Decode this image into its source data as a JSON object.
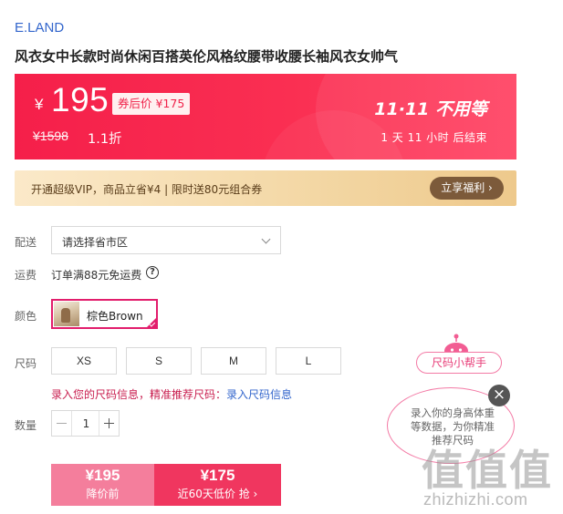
{
  "brand": "E.LAND",
  "product_title": "风衣女中长款时尚休闲百搭英伦风格纹腰带收腰长袖风衣女帅气",
  "price_banner": {
    "currency": "¥",
    "price": "195",
    "coupon_tag": "券后价 ¥175",
    "original_price": "¥1598",
    "discount": "1.1折",
    "promo_title": "11·11 不用等",
    "countdown": "1 天 11 小时 后结束"
  },
  "vip": {
    "text": "开通超级VIP，商品立省¥4 | 限时送80元组合券",
    "button": "立享福利 ›"
  },
  "delivery": {
    "label": "配送",
    "placeholder": "请选择省市区"
  },
  "freight": {
    "label": "运费",
    "text": "订单满88元免运费",
    "help_icon": "?"
  },
  "color": {
    "label": "颜色",
    "selected": "棕色Brown"
  },
  "size": {
    "label": "尺码",
    "options": [
      "XS",
      "S",
      "M",
      "L"
    ],
    "hint": "录入您的尺码信息，精准推荐尺码：",
    "hint_link": "录入尺码信息"
  },
  "quantity": {
    "label": "数量",
    "value": "1"
  },
  "buy": {
    "left_price": "¥195",
    "left_sub": "降价前",
    "right_price": "¥175",
    "right_sub": "近60天低价 抢 ›"
  },
  "size_helper": {
    "pill": "尺码小帮手",
    "bubble_text": "录入你的身高体重等数据，为你精准推荐尺码",
    "close": "×"
  },
  "watermark": {
    "glyphs": [
      "值",
      "值",
      "值"
    ],
    "url": "zhizhizhi.com"
  },
  "colors": {
    "brand_link": "#3366cc",
    "price_red": "#f51f4a",
    "accent_pink": "#e21d6c"
  }
}
